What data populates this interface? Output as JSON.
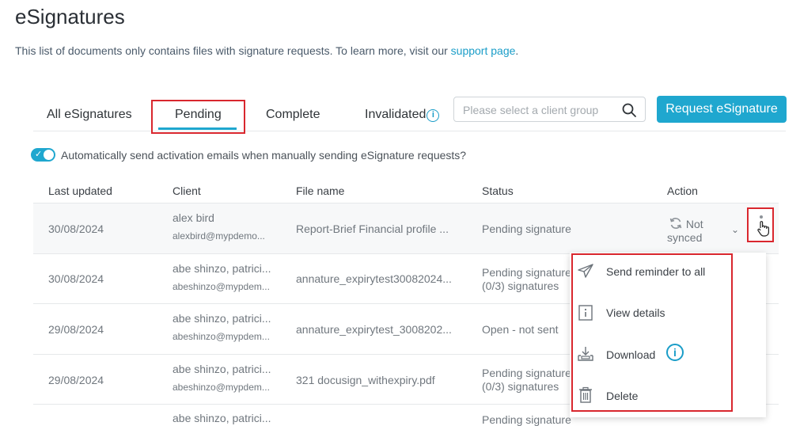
{
  "page": {
    "title": "eSignatures",
    "intro_text": "This list of documents only contains files with signature requests. To learn more, visit our ",
    "intro_link": "support page",
    "intro_end": "."
  },
  "tabs": [
    {
      "label": "All eSignatures"
    },
    {
      "label": "Pending",
      "active": true
    },
    {
      "label": "Complete"
    },
    {
      "label": "Invalidated"
    }
  ],
  "search": {
    "placeholder": "Please select a client group"
  },
  "request_button": "Request eSignature",
  "auto_send": {
    "enabled": true,
    "label": "Automatically send activation emails when manually sending eSignature requests?"
  },
  "table": {
    "headers": [
      "Last updated",
      "Client",
      "File name",
      "Status",
      "Action"
    ],
    "rows": [
      {
        "date": "30/08/2024",
        "client_name": "alex bird",
        "client_email": "alexbird@mypdemo...",
        "file": "Report-Brief Financial profile ...",
        "status": "Pending signature",
        "status2": "",
        "action": "Not synced"
      },
      {
        "date": "30/08/2024",
        "client_name": "abe shinzo, patrici...",
        "client_email": "abeshinzo@mypdem...",
        "file": "annature_expirytest30082024...",
        "status": "Pending signature",
        "status2": "(0/3) signatures"
      },
      {
        "date": "29/08/2024",
        "client_name": "abe shinzo, patrici...",
        "client_email": "abeshinzo@mypdem...",
        "file": "annature_expirytest_3008202...",
        "status": "Open - not sent",
        "status2": ""
      },
      {
        "date": "29/08/2024",
        "client_name": "abe shinzo, patrici...",
        "client_email": "abeshinzo@mypdem...",
        "file": "321 docusign_withexpiry.pdf",
        "status": "Pending signature",
        "status2": "(0/3) signatures"
      },
      {
        "date": "",
        "client_name": "abe shinzo, patrici...",
        "client_email": "",
        "file": "",
        "status": "Pending signature",
        "status2": ""
      }
    ]
  },
  "action_sync": {
    "line1": "Not",
    "line2": "synced"
  },
  "context_menu": {
    "items": [
      {
        "label": "Send reminder to all",
        "icon": "send-icon"
      },
      {
        "label": "View details",
        "icon": "info-box-icon"
      },
      {
        "label": "Download",
        "icon": "download-icon"
      },
      {
        "label": "Delete",
        "icon": "trash-icon"
      }
    ]
  },
  "colors": {
    "accent": "#1fa7cf",
    "highlight": "#d9272e"
  }
}
